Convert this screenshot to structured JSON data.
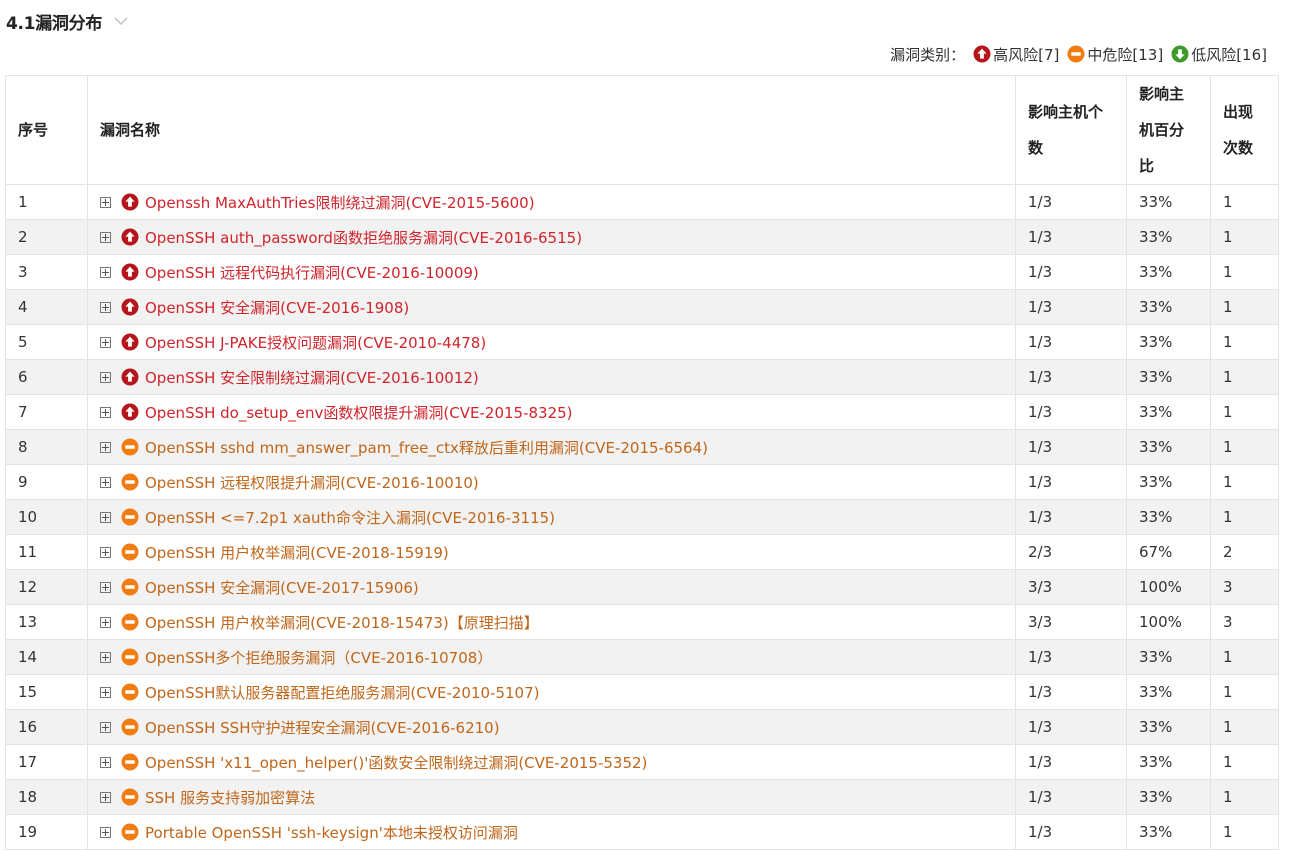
{
  "section": {
    "title": "4.1漏洞分布"
  },
  "legend": {
    "label": "漏洞类别：",
    "items": [
      {
        "severity": "high",
        "text": "高风险[7]"
      },
      {
        "severity": "medium",
        "text": "中危险[13]"
      },
      {
        "severity": "low",
        "text": "低风险[16]"
      }
    ]
  },
  "colors": {
    "high": "#d0242b",
    "high_icon": "#b5151b",
    "medium": "#c0661a",
    "medium_icon": "#f07c12",
    "low_icon": "#3f9a2c"
  },
  "table": {
    "headers": {
      "index": "序号",
      "name": "漏洞名称",
      "hosts": "影响主机个数",
      "percent": "影响主机百分比",
      "count": "出现次数"
    },
    "rows": [
      {
        "index": "1",
        "severity": "high",
        "name": "Openssh MaxAuthTries限制绕过漏洞(CVE-2015-5600)",
        "hosts": "1/3",
        "percent": "33%",
        "count": "1"
      },
      {
        "index": "2",
        "severity": "high",
        "name": "OpenSSH auth_password函数拒绝服务漏洞(CVE-2016-6515)",
        "hosts": "1/3",
        "percent": "33%",
        "count": "1"
      },
      {
        "index": "3",
        "severity": "high",
        "name": "OpenSSH 远程代码执行漏洞(CVE-2016-10009)",
        "hosts": "1/3",
        "percent": "33%",
        "count": "1"
      },
      {
        "index": "4",
        "severity": "high",
        "name": "OpenSSH 安全漏洞(CVE-2016-1908)",
        "hosts": "1/3",
        "percent": "33%",
        "count": "1"
      },
      {
        "index": "5",
        "severity": "high",
        "name": "OpenSSH J-PAKE授权问题漏洞(CVE-2010-4478)",
        "hosts": "1/3",
        "percent": "33%",
        "count": "1"
      },
      {
        "index": "6",
        "severity": "high",
        "name": "OpenSSH 安全限制绕过漏洞(CVE-2016-10012)",
        "hosts": "1/3",
        "percent": "33%",
        "count": "1"
      },
      {
        "index": "7",
        "severity": "high",
        "name": "OpenSSH do_setup_env函数权限提升漏洞(CVE-2015-8325)",
        "hosts": "1/3",
        "percent": "33%",
        "count": "1"
      },
      {
        "index": "8",
        "severity": "medium",
        "name": "OpenSSH sshd mm_answer_pam_free_ctx释放后重利用漏洞(CVE-2015-6564)",
        "hosts": "1/3",
        "percent": "33%",
        "count": "1"
      },
      {
        "index": "9",
        "severity": "medium",
        "name": "OpenSSH 远程权限提升漏洞(CVE-2016-10010)",
        "hosts": "1/3",
        "percent": "33%",
        "count": "1"
      },
      {
        "index": "10",
        "severity": "medium",
        "name": "OpenSSH <=7.2p1 xauth命令注入漏洞(CVE-2016-3115)",
        "hosts": "1/3",
        "percent": "33%",
        "count": "1"
      },
      {
        "index": "11",
        "severity": "medium",
        "name": "OpenSSH 用户枚举漏洞(CVE-2018-15919)",
        "hosts": "2/3",
        "percent": "67%",
        "count": "2"
      },
      {
        "index": "12",
        "severity": "medium",
        "name": "OpenSSH 安全漏洞(CVE-2017-15906)",
        "hosts": "3/3",
        "percent": "100%",
        "count": "3"
      },
      {
        "index": "13",
        "severity": "medium",
        "name": "OpenSSH 用户枚举漏洞(CVE-2018-15473)【原理扫描】",
        "hosts": "3/3",
        "percent": "100%",
        "count": "3"
      },
      {
        "index": "14",
        "severity": "medium",
        "name": "OpenSSH多个拒绝服务漏洞（CVE-2016-10708）",
        "hosts": "1/3",
        "percent": "33%",
        "count": "1"
      },
      {
        "index": "15",
        "severity": "medium",
        "name": "OpenSSH默认服务器配置拒绝服务漏洞(CVE-2010-5107)",
        "hosts": "1/3",
        "percent": "33%",
        "count": "1"
      },
      {
        "index": "16",
        "severity": "medium",
        "name": "OpenSSH SSH守护进程安全漏洞(CVE-2016-6210)",
        "hosts": "1/3",
        "percent": "33%",
        "count": "1"
      },
      {
        "index": "17",
        "severity": "medium",
        "name": "OpenSSH 'x11_open_helper()'函数安全限制绕过漏洞(CVE-2015-5352)",
        "hosts": "1/3",
        "percent": "33%",
        "count": "1"
      },
      {
        "index": "18",
        "severity": "medium",
        "name": "SSH 服务支持弱加密算法",
        "hosts": "1/3",
        "percent": "33%",
        "count": "1"
      },
      {
        "index": "19",
        "severity": "medium",
        "name": "Portable OpenSSH 'ssh-keysign'本地未授权访问漏洞",
        "hosts": "1/3",
        "percent": "33%",
        "count": "1"
      }
    ]
  }
}
